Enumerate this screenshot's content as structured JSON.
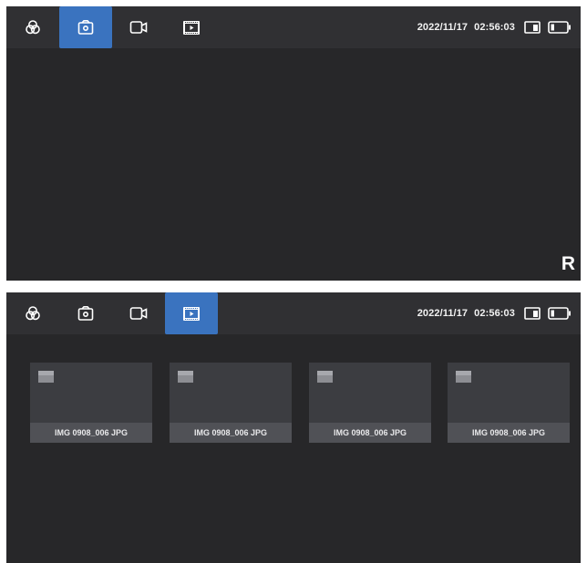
{
  "colors": {
    "screen_bg": "#272729",
    "bar_bg": "#303033",
    "accent": "#3a73bf",
    "thumb_bg": "#3c3d41",
    "caption_bg": "#505156"
  },
  "top_screen": {
    "tabs": [
      {
        "icon": "filter-icon",
        "active": false
      },
      {
        "icon": "photo-camera-icon",
        "active": true
      },
      {
        "icon": "video-camera-icon",
        "active": false
      },
      {
        "icon": "playback-icon",
        "active": false
      }
    ],
    "status": {
      "date": "2022/11/17",
      "time": "02:56:03",
      "sd_icon": "sd-card-icon",
      "battery_icon": "battery-icon"
    },
    "mode_letter": "R"
  },
  "bottom_screen": {
    "tabs": [
      {
        "icon": "filter-icon",
        "active": false
      },
      {
        "icon": "photo-camera-icon",
        "active": false
      },
      {
        "icon": "video-camera-icon",
        "active": false
      },
      {
        "icon": "playback-icon",
        "active": true
      }
    ],
    "status": {
      "date": "2022/11/17",
      "time": "02:56:03",
      "sd_icon": "sd-card-icon",
      "battery_icon": "battery-icon"
    },
    "files": [
      {
        "name": "IMG 0908_006 JPG",
        "icon": "image-placeholder-icon"
      },
      {
        "name": "IMG 0908_006 JPG",
        "icon": "image-placeholder-icon"
      },
      {
        "name": "IMG 0908_006 JPG",
        "icon": "image-placeholder-icon"
      },
      {
        "name": "IMG 0908_006 JPG",
        "icon": "image-placeholder-icon"
      }
    ]
  }
}
